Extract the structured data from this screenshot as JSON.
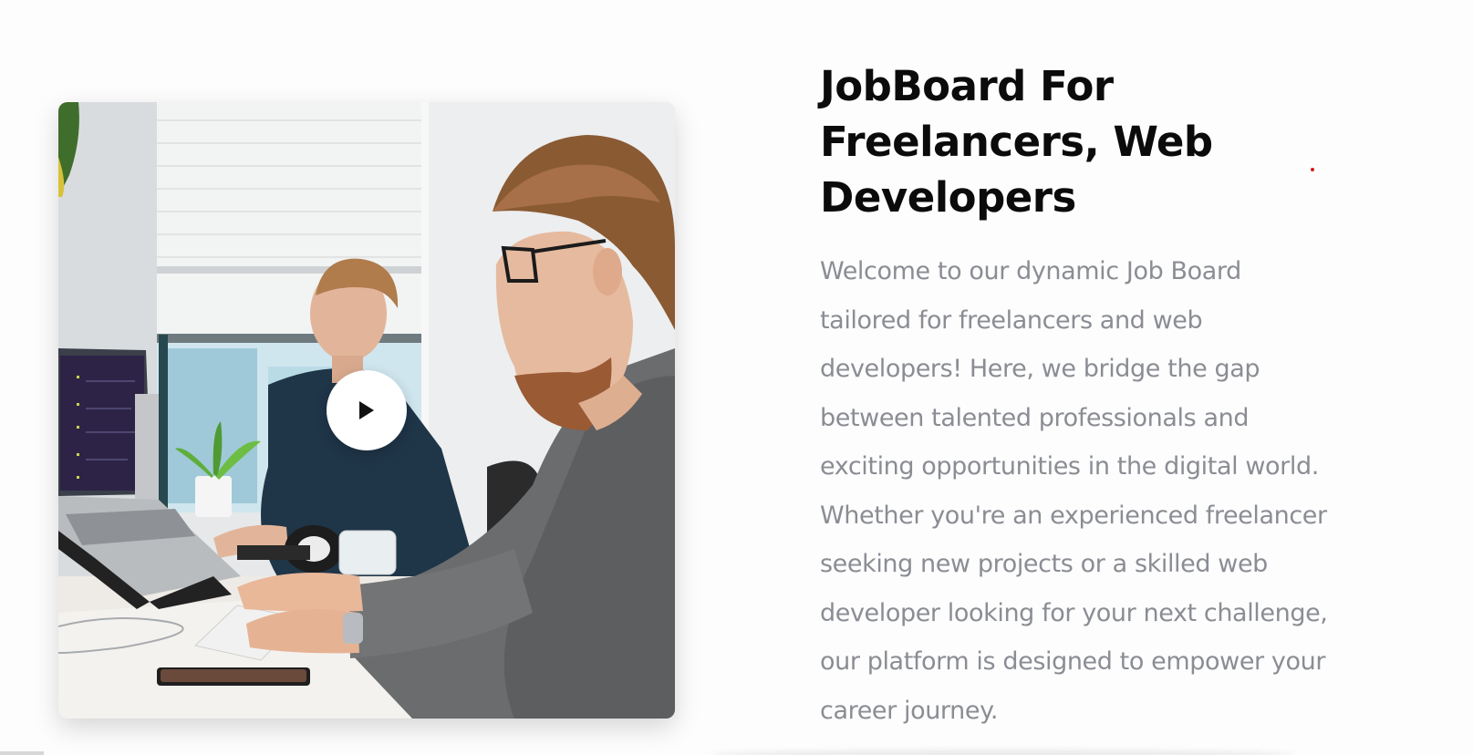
{
  "hero": {
    "heading": "JobBoard For Freelancers, Web Developers",
    "description": "Welcome to our dynamic Job Board tailored for freelancers and web developers! Here, we bridge the gap between talented professionals and exciting opportunities in the digital world. Whether you're an experienced freelancer seeking new projects or a skilled web developer looking for your next challenge, our platform is designed to empower your career journey."
  },
  "media": {
    "play_icon": "play-icon"
  },
  "colors": {
    "heading": "#0b0b0b",
    "body_text": "#8a8d93",
    "accent_dot": "#d01d1d"
  }
}
